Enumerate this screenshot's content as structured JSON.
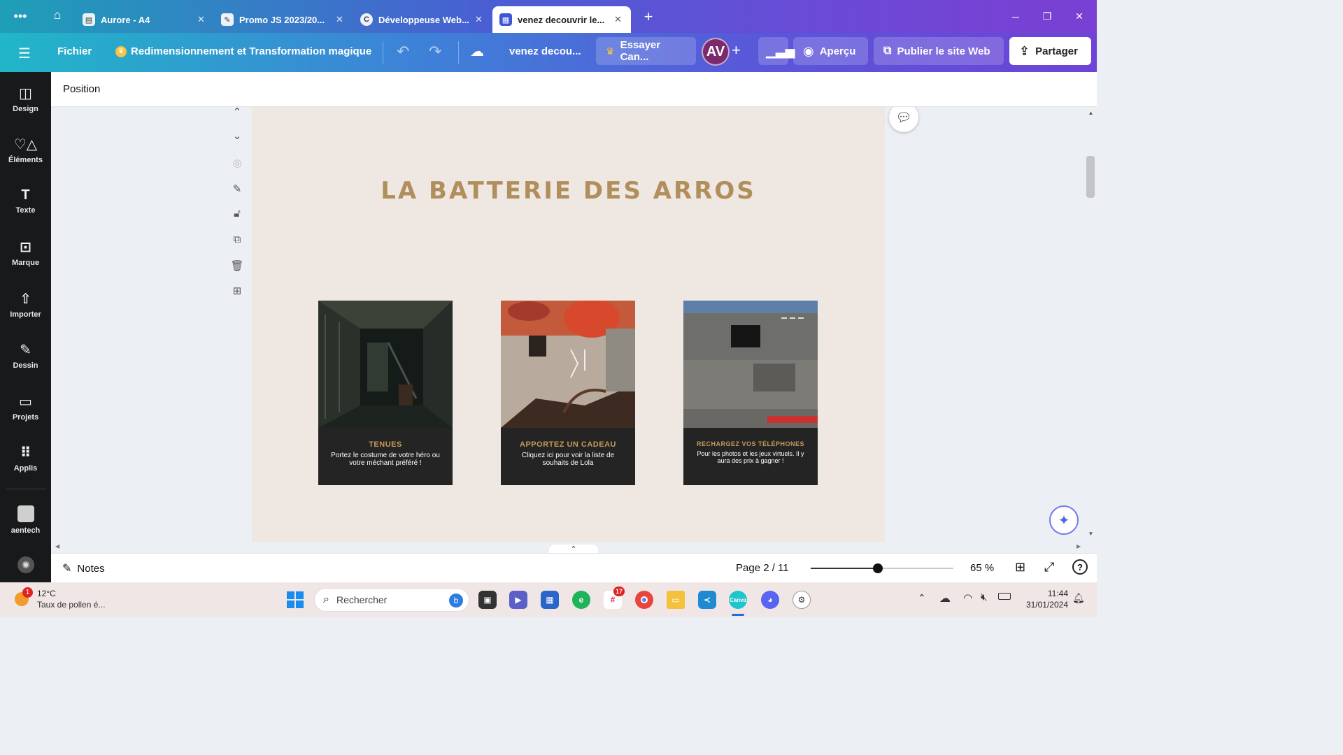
{
  "browser": {
    "tabs": [
      {
        "title": "Aurore - A4",
        "icon": "printer-icon"
      },
      {
        "title": "Promo JS 2023/20...",
        "icon": "chat-icon"
      },
      {
        "title": "Développeuse Web...",
        "icon": "c-logo-icon"
      },
      {
        "title": "venez decouvrir le...",
        "icon": "calendar-icon",
        "active": true
      }
    ],
    "new_tab": "+"
  },
  "header": {
    "menu_icon": "hamburger-icon",
    "file_label": "Fichier",
    "resize_label": "Redimensionnement et Transformation magique",
    "doc_title": "venez decou...",
    "try_label": "Essayer Can...",
    "avatar_initials": "AV",
    "preview_label": "Aperçu",
    "publish_label": "Publier le site Web",
    "share_label": "Partager"
  },
  "sidebar": {
    "items": [
      {
        "label": "Design",
        "icon": "layout-icon"
      },
      {
        "label": "Éléments",
        "icon": "shapes-icon"
      },
      {
        "label": "Texte",
        "icon": "text-icon"
      },
      {
        "label": "Marque",
        "icon": "brand-icon"
      },
      {
        "label": "Importer",
        "icon": "upload-icon"
      },
      {
        "label": "Dessin",
        "icon": "draw-icon"
      },
      {
        "label": "Projets",
        "icon": "folder-icon"
      },
      {
        "label": "Applis",
        "icon": "apps-icon"
      },
      {
        "label": "aentech",
        "icon": "team-icon"
      }
    ]
  },
  "toolbar": {
    "position_label": "Position"
  },
  "page": {
    "title": "LA BATTERIE DES ARROS",
    "cards": [
      {
        "title": "TENUES",
        "text": "Portez le costume de votre héro ou votre méchant préféré !"
      },
      {
        "title": "APPORTEZ UN CADEAU",
        "text": "Cliquez ici pour voir la liste de souhaits de Lola"
      },
      {
        "title": "RECHARGEZ VOS TÉLÉPHONES",
        "text": "Pour les photos et les jeux virtuels. Il y aura des prix à gagner !"
      }
    ]
  },
  "footer": {
    "notes_label": "Notes",
    "page_indicator": "Page 2 / 11",
    "zoom": "65 %",
    "zoom_fraction": 0.47
  },
  "taskbar": {
    "weather_temp": "12°C",
    "weather_text": "Taux de pollen é...",
    "weather_badge": "1",
    "search_placeholder": "Rechercher",
    "slack_badge": "17",
    "time": "11:44",
    "date": "31/01/2024"
  },
  "colors": {
    "title_gold": "#b18f5d",
    "card_bg": "#242424",
    "page_bg": "#efe8e2",
    "sidebar_bg": "#18191b"
  }
}
